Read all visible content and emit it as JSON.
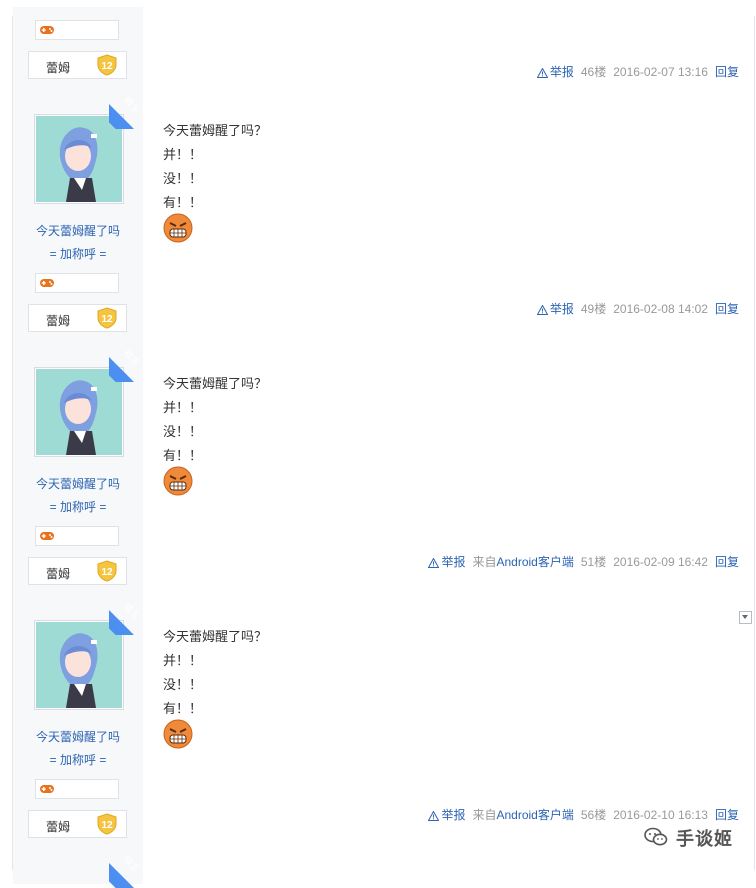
{
  "posts": [
    {
      "floor_owner_tag": "",
      "user": {
        "name": "",
        "title": "",
        "level_name": "蕾姆",
        "level": "12"
      },
      "content": [],
      "tail": {
        "report": "举报",
        "source_prefix": "",
        "source_link": "",
        "source_suffix": "",
        "floor": "46楼",
        "time": "2016-02-07 13:16",
        "reply": "回复"
      }
    },
    {
      "floor_owner_tag": "楼主",
      "user": {
        "name": "今天蕾姆醒了吗",
        "title": "= 加称呼 =",
        "level_name": "蕾姆",
        "level": "12"
      },
      "content": [
        "今天蕾姆醒了吗？",
        "并！！",
        "没！！",
        "有！！"
      ],
      "tail": {
        "report": "举报",
        "source_prefix": "",
        "source_link": "",
        "source_suffix": "",
        "floor": "49楼",
        "time": "2016-02-08 14:02",
        "reply": "回复"
      }
    },
    {
      "floor_owner_tag": "楼主",
      "user": {
        "name": "今天蕾姆醒了吗",
        "title": "= 加称呼 =",
        "level_name": "蕾姆",
        "level": "12"
      },
      "content": [
        "今天蕾姆醒了吗？",
        "并！！",
        "没！！",
        "有！！"
      ],
      "tail": {
        "report": "举报",
        "source_prefix": "来自",
        "source_link": "Android",
        "source_suffix": "客户端",
        "floor": "51楼",
        "time": "2016-02-09 16:42",
        "reply": "回复"
      }
    },
    {
      "floor_owner_tag": "楼主",
      "user": {
        "name": "今天蕾姆醒了吗",
        "title": "= 加称呼 =",
        "level_name": "蕾姆",
        "level": "12"
      },
      "content": [
        "今天蕾姆醒了吗？",
        "并！！",
        "没！！",
        "有！！"
      ],
      "tail": {
        "report": "举报",
        "source_prefix": "来自",
        "source_link": "Android",
        "source_suffix": "客户端",
        "floor": "56楼",
        "time": "2016-02-10 16:13",
        "reply": "回复"
      }
    },
    {
      "floor_owner_tag": "楼主"
    }
  ],
  "watermark": {
    "text": "手谈姬",
    "icon": "wechat-icon"
  },
  "colors": {
    "link": "#2d64b3",
    "lz_badge": "#4c8ff0",
    "side_bg": "#f7f8fa",
    "level_shield": "#f5c542"
  }
}
